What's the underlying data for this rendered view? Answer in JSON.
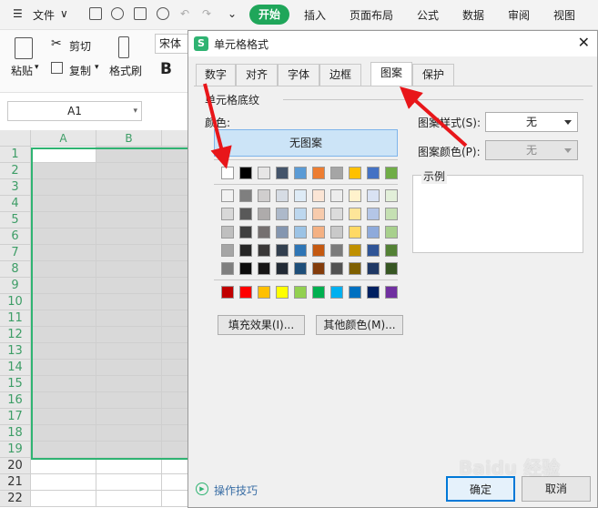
{
  "menubar": {
    "file_label": "文件",
    "tabs": [
      "开始",
      "插入",
      "页面布局",
      "公式",
      "数据",
      "审阅",
      "视图"
    ]
  },
  "ribbon": {
    "cut_label": "剪切",
    "paste_label": "粘贴",
    "copy_label": "复制",
    "format_painter_label": "格式刷",
    "font_name": "宋体",
    "bold_label": "B"
  },
  "sheet": {
    "name_box": "A1",
    "columns": [
      "A",
      "B"
    ],
    "rows": [
      "1",
      "2",
      "3",
      "4",
      "5",
      "6",
      "7",
      "8",
      "9",
      "10",
      "11",
      "12",
      "13",
      "14",
      "15",
      "16",
      "17",
      "18",
      "19",
      "20",
      "21",
      "22"
    ]
  },
  "dialog": {
    "title": "单元格格式",
    "tabs": [
      "数字",
      "对齐",
      "字体",
      "边框",
      "图案",
      "保护"
    ],
    "active_tab": "图案",
    "shading_group": "单元格底纹",
    "color_label": "颜色:",
    "no_color_button": "无图案",
    "fill_effects_button": "填充效果(I)...",
    "more_colors_button": "其他颜色(M)...",
    "pattern_style_label": "图案样式(S):",
    "pattern_style_value": "无",
    "pattern_color_label": "图案颜色(P):",
    "pattern_color_value": "无",
    "sample_label": "示例",
    "tips_link": "操作技巧",
    "ok_button": "确定",
    "cancel_button": "取消",
    "palette_row1": [
      "#ffffff",
      "#000000",
      "#e7e6e6",
      "#44546a",
      "#5b9bd5",
      "#ed7d31",
      "#a5a5a5",
      "#ffc000",
      "#4472c4",
      "#70ad47"
    ],
    "palette_rows": [
      [
        "#f2f2f2",
        "#7f7f7f",
        "#d0cece",
        "#d6dce4",
        "#deebf6",
        "#fbe5d5",
        "#ededed",
        "#fff2cc",
        "#d9e2f3",
        "#e2efd9"
      ],
      [
        "#d8d8d8",
        "#595959",
        "#aeabab",
        "#adb9ca",
        "#bdd7ee",
        "#f7cbac",
        "#dbdbdb",
        "#fee599",
        "#b4c6e7",
        "#c5e0b3"
      ],
      [
        "#bfbfbf",
        "#3f3f3f",
        "#757070",
        "#8496b0",
        "#9cc3e5",
        "#f4b183",
        "#c9c9c9",
        "#ffd965",
        "#8eaadb",
        "#a8d08d"
      ],
      [
        "#a5a5a5",
        "#262626",
        "#3a3838",
        "#323f4f",
        "#2e75b5",
        "#c45911",
        "#7b7b7b",
        "#bf9000",
        "#2f5496",
        "#538135"
      ],
      [
        "#7f7f7f",
        "#0c0c0c",
        "#171616",
        "#222a35",
        "#1e4e79",
        "#833c0b",
        "#525252",
        "#7f6000",
        "#1f3864",
        "#375623"
      ]
    ],
    "palette_standard": [
      "#c00000",
      "#ff0000",
      "#ffc000",
      "#ffff00",
      "#92d050",
      "#00b050",
      "#00b0f0",
      "#0070c0",
      "#002060",
      "#7030a0"
    ]
  },
  "watermark": "Baidu 经验"
}
